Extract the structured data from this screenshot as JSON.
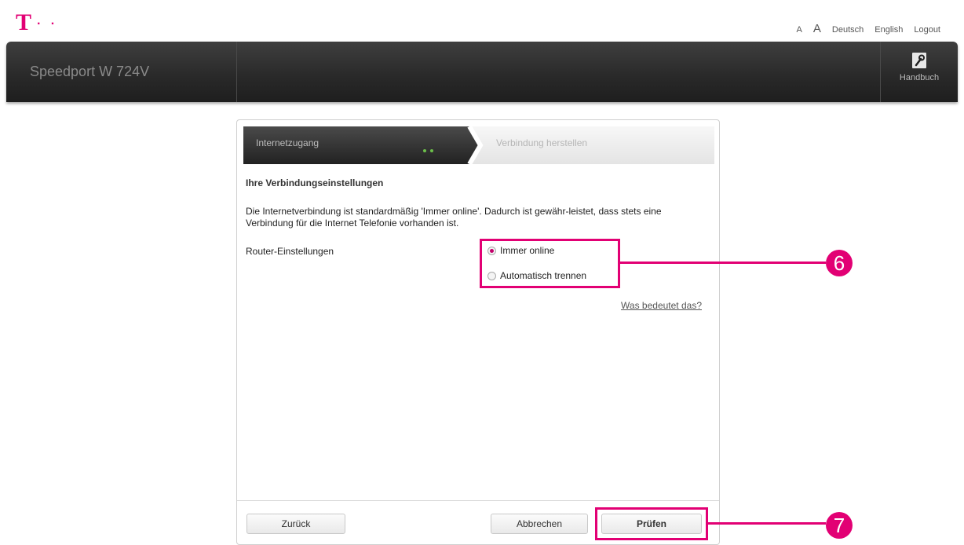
{
  "brand": {
    "logo_letter": "T",
    "logo_dots": "· ·"
  },
  "toplinks": {
    "font_small": "A",
    "font_large": "A",
    "lang_de": "Deutsch",
    "lang_en": "English",
    "logout": "Logout"
  },
  "header": {
    "product": "Speedport W 724V",
    "manual": "Handbuch",
    "manual_icon": "wrench-icon"
  },
  "steps": {
    "step1": "Internetzugang",
    "step2": "Verbindung herstellen",
    "active_color": "#6cc04a"
  },
  "main": {
    "title": "Ihre Verbindungseinstellungen",
    "description": "Die Internetverbindung ist standardmäßig 'Immer online'. Dadurch ist gewähr-leistet, dass stets eine Verbindung für die Internet Telefonie vorhanden ist.",
    "router_label": "Router-Einstellungen",
    "options": [
      {
        "label": "Immer online",
        "selected": true
      },
      {
        "label": "Automatisch trennen",
        "selected": false
      }
    ],
    "help_link": "Was bedeutet das?"
  },
  "buttons": {
    "back": "Zurück",
    "cancel": "Abbrechen",
    "check": "Prüfen"
  },
  "annotations": {
    "marker1": "6",
    "marker2": "7",
    "color": "#e20074"
  }
}
